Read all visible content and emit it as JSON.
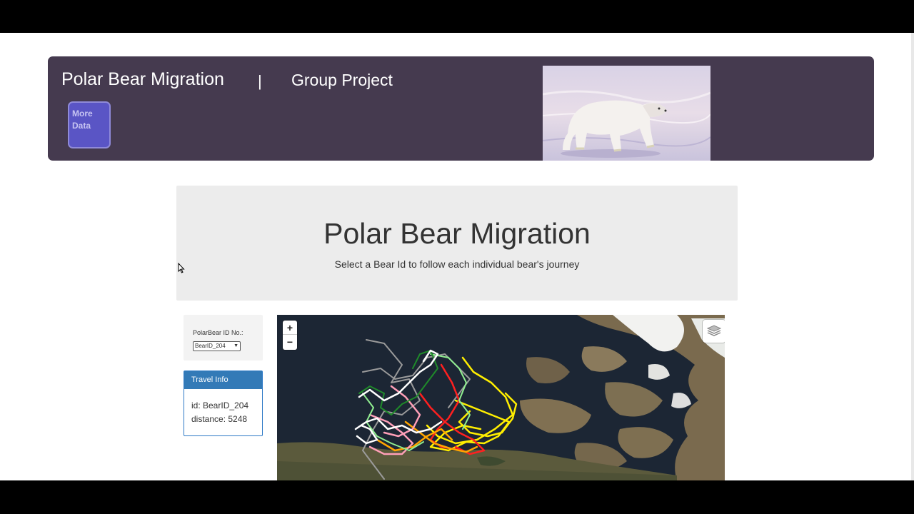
{
  "header": {
    "title": "Polar Bear Migration",
    "separator": "|",
    "subtitle": "Group Project",
    "more_data_label": "More Data"
  },
  "jumbotron": {
    "title": "Polar Bear Migration",
    "subtitle": "Select a Bear Id to follow each individual bear's journey"
  },
  "selector": {
    "label": "PolarBear ID No.:",
    "selected": "BearID_204"
  },
  "travel_info": {
    "heading": "Travel Info",
    "id_line": "id: BearID_204",
    "distance_line": "distance: 5248"
  },
  "map": {
    "zoom_in": "+",
    "zoom_out": "−",
    "track_colors": [
      "#ffffff",
      "#ff2020",
      "#ffee00",
      "#ffa500",
      "#90ee90",
      "#ff9fb8",
      "#9a9a9a",
      "#1f8a2a"
    ]
  }
}
